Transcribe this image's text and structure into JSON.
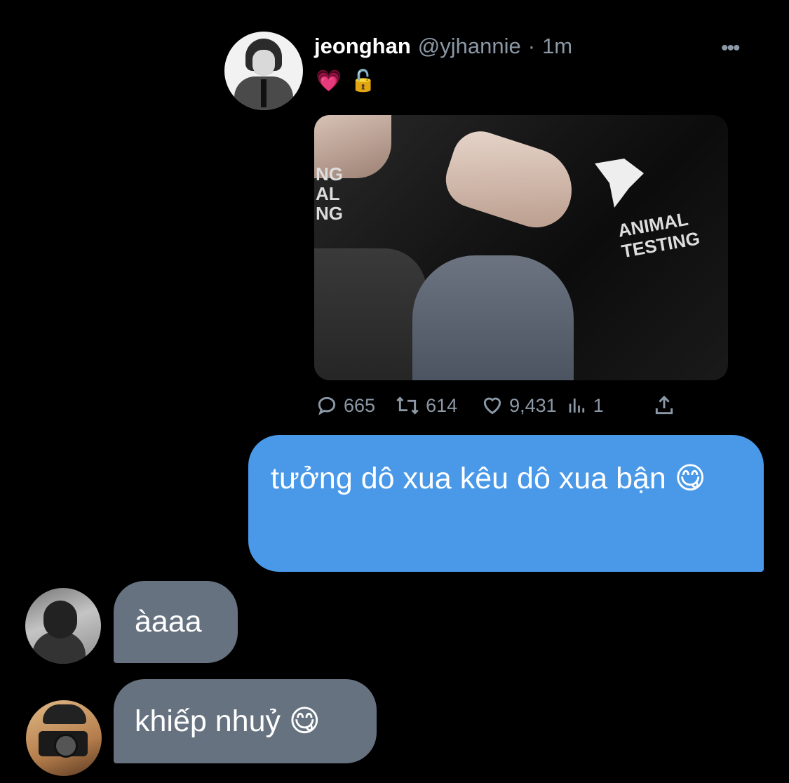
{
  "tweet": {
    "author_name": "jeonghan",
    "author_handle": "@yjhannie",
    "separator": "·",
    "time": "1m",
    "more_label": "•••",
    "text_emoji": [
      "💗",
      "🔓"
    ],
    "media_text_left": "NG\nAL\nNG",
    "media_text_right": "ANIMAL\nTESTING",
    "stats": {
      "replies": "665",
      "retweets": "614",
      "likes": "9,431",
      "views": "1"
    }
  },
  "messages": {
    "sent_1": "tưởng dô xua kêu dô xua bận 😋",
    "received_1": "àaaa",
    "received_2": "khiếp nhuỷ 😋"
  },
  "colors": {
    "background": "#000000",
    "sent_bubble": "#4a99e9",
    "received_bubble": "#66727f",
    "muted_text": "#8b98a5"
  },
  "icons": [
    "reply-icon",
    "retweet-icon",
    "like-icon",
    "views-icon",
    "share-icon",
    "more-icon",
    "heart-emoji",
    "lock-emoji"
  ]
}
